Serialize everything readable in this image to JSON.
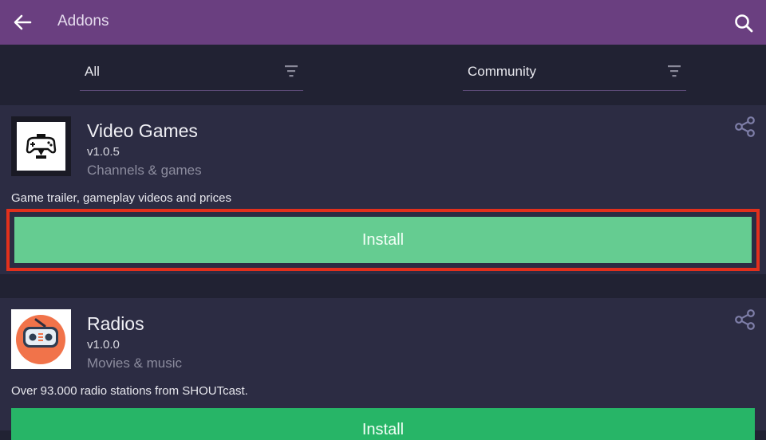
{
  "appbar": {
    "title": "Addons",
    "color": "#6a3f80"
  },
  "filters": [
    {
      "label": "All"
    },
    {
      "label": "Community"
    }
  ],
  "addons": [
    {
      "name": "Video Games",
      "version": "v1.0.5",
      "category": "Channels & games",
      "description": "Game trailer, gameplay videos and prices",
      "install_label": "Install",
      "icon": "gamepad-icon"
    },
    {
      "name": "Radios",
      "version": "v1.0.0",
      "category": "Movies & music",
      "description": "Over 93.000 radio stations from SHOUTcast.",
      "install_label": "Install",
      "icon": "radio-icon"
    }
  ],
  "colors": {
    "install_highlighted": "#65cc91",
    "install": "#27b567",
    "highlight_border": "#e2301c"
  }
}
